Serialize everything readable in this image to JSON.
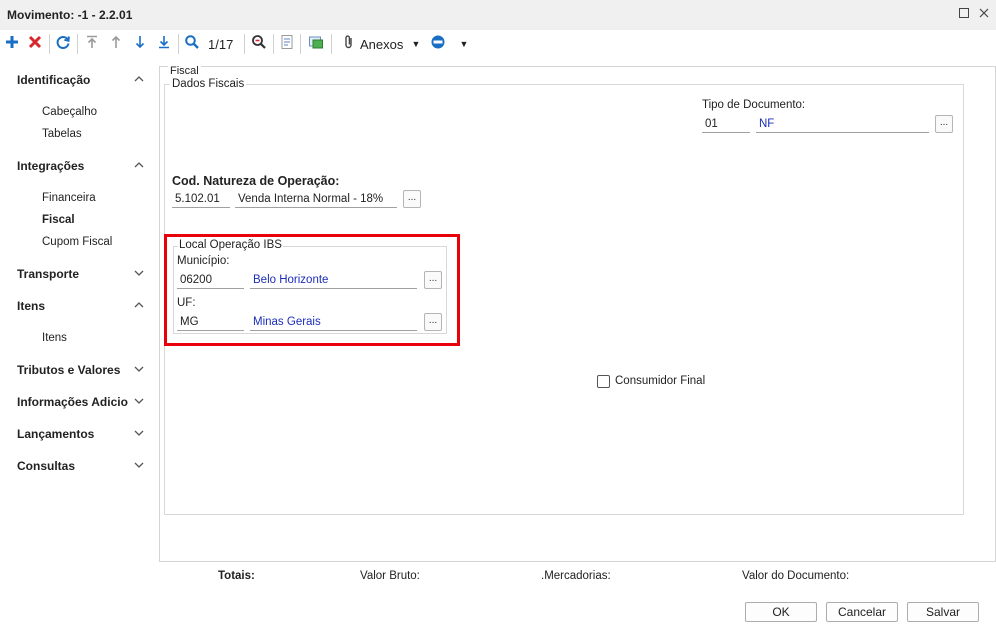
{
  "window": {
    "title": "Movimento: -1 - 2.2.01"
  },
  "toolbar": {
    "record_counter": "1/17",
    "anexos_label": "Anexos"
  },
  "sidebar": {
    "sections": [
      {
        "label": "Identificação",
        "chevron": "^",
        "items": [
          "Cabeçalho",
          "Tabelas"
        ]
      },
      {
        "label": "Integrações",
        "chevron": "^",
        "items": [
          "Financeira",
          "Fiscal",
          "Cupom Fiscal"
        ]
      },
      {
        "label": "Transporte",
        "chevron": "v"
      },
      {
        "label": "Itens",
        "chevron": "^",
        "items": [
          "Itens"
        ]
      },
      {
        "label": "Tributos e Valores",
        "chevron": "v"
      },
      {
        "label": "Informações Adicio",
        "chevron": "v"
      },
      {
        "label": "Lançamentos",
        "chevron": "v"
      },
      {
        "label": "Consultas",
        "chevron": "v"
      }
    ],
    "selected_item": "Fiscal"
  },
  "main": {
    "group_label": "Fiscal",
    "dados_label": "Dados Fiscais",
    "tipo_documento": {
      "label": "Tipo de Documento:",
      "code": "01",
      "desc": "NF",
      "lookup": "..."
    },
    "natureza": {
      "label": "Cod. Natureza de Operação:",
      "code": "5.102.01",
      "desc": "Venda Interna Normal - 18%",
      "lookup": "..."
    },
    "ibs": {
      "label": "Local Operação IBS",
      "municipio": {
        "label": "Município:",
        "code": "06200",
        "desc": "Belo Horizonte",
        "lookup": "..."
      },
      "uf": {
        "label": "UF:",
        "code": "MG",
        "desc": "Minas Gerais",
        "lookup": "..."
      }
    },
    "consumidor_final": {
      "label": "Consumidor Final",
      "checked": false
    }
  },
  "footer": {
    "totais": "Totais:",
    "valor_bruto": "Valor Bruto:",
    "mercadorias": ".Mercadorias:",
    "valor_documento": "Valor do Documento:",
    "ok": "OK",
    "cancelar": "Cancelar",
    "salvar": "Salvar"
  },
  "colors": {
    "accent_blue": "#1a6fc4",
    "delete_red": "#d9262c",
    "highlight_red": "#e8000b",
    "value_blue": "#1c2db8"
  }
}
